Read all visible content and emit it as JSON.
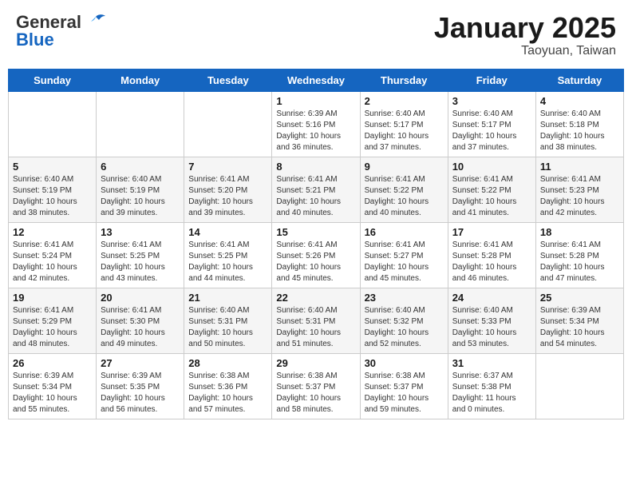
{
  "header": {
    "logo_general": "General",
    "logo_blue": "Blue",
    "title": "January 2025",
    "subtitle": "Taoyuan, Taiwan"
  },
  "days_of_week": [
    "Sunday",
    "Monday",
    "Tuesday",
    "Wednesday",
    "Thursday",
    "Friday",
    "Saturday"
  ],
  "weeks": [
    [
      {
        "day": "",
        "sunrise": "",
        "sunset": "",
        "daylight": ""
      },
      {
        "day": "",
        "sunrise": "",
        "sunset": "",
        "daylight": ""
      },
      {
        "day": "",
        "sunrise": "",
        "sunset": "",
        "daylight": ""
      },
      {
        "day": "1",
        "sunrise": "Sunrise: 6:39 AM",
        "sunset": "Sunset: 5:16 PM",
        "daylight": "Daylight: 10 hours and 36 minutes."
      },
      {
        "day": "2",
        "sunrise": "Sunrise: 6:40 AM",
        "sunset": "Sunset: 5:17 PM",
        "daylight": "Daylight: 10 hours and 37 minutes."
      },
      {
        "day": "3",
        "sunrise": "Sunrise: 6:40 AM",
        "sunset": "Sunset: 5:17 PM",
        "daylight": "Daylight: 10 hours and 37 minutes."
      },
      {
        "day": "4",
        "sunrise": "Sunrise: 6:40 AM",
        "sunset": "Sunset: 5:18 PM",
        "daylight": "Daylight: 10 hours and 38 minutes."
      }
    ],
    [
      {
        "day": "5",
        "sunrise": "Sunrise: 6:40 AM",
        "sunset": "Sunset: 5:19 PM",
        "daylight": "Daylight: 10 hours and 38 minutes."
      },
      {
        "day": "6",
        "sunrise": "Sunrise: 6:40 AM",
        "sunset": "Sunset: 5:19 PM",
        "daylight": "Daylight: 10 hours and 39 minutes."
      },
      {
        "day": "7",
        "sunrise": "Sunrise: 6:41 AM",
        "sunset": "Sunset: 5:20 PM",
        "daylight": "Daylight: 10 hours and 39 minutes."
      },
      {
        "day": "8",
        "sunrise": "Sunrise: 6:41 AM",
        "sunset": "Sunset: 5:21 PM",
        "daylight": "Daylight: 10 hours and 40 minutes."
      },
      {
        "day": "9",
        "sunrise": "Sunrise: 6:41 AM",
        "sunset": "Sunset: 5:22 PM",
        "daylight": "Daylight: 10 hours and 40 minutes."
      },
      {
        "day": "10",
        "sunrise": "Sunrise: 6:41 AM",
        "sunset": "Sunset: 5:22 PM",
        "daylight": "Daylight: 10 hours and 41 minutes."
      },
      {
        "day": "11",
        "sunrise": "Sunrise: 6:41 AM",
        "sunset": "Sunset: 5:23 PM",
        "daylight": "Daylight: 10 hours and 42 minutes."
      }
    ],
    [
      {
        "day": "12",
        "sunrise": "Sunrise: 6:41 AM",
        "sunset": "Sunset: 5:24 PM",
        "daylight": "Daylight: 10 hours and 42 minutes."
      },
      {
        "day": "13",
        "sunrise": "Sunrise: 6:41 AM",
        "sunset": "Sunset: 5:25 PM",
        "daylight": "Daylight: 10 hours and 43 minutes."
      },
      {
        "day": "14",
        "sunrise": "Sunrise: 6:41 AM",
        "sunset": "Sunset: 5:25 PM",
        "daylight": "Daylight: 10 hours and 44 minutes."
      },
      {
        "day": "15",
        "sunrise": "Sunrise: 6:41 AM",
        "sunset": "Sunset: 5:26 PM",
        "daylight": "Daylight: 10 hours and 45 minutes."
      },
      {
        "day": "16",
        "sunrise": "Sunrise: 6:41 AM",
        "sunset": "Sunset: 5:27 PM",
        "daylight": "Daylight: 10 hours and 45 minutes."
      },
      {
        "day": "17",
        "sunrise": "Sunrise: 6:41 AM",
        "sunset": "Sunset: 5:28 PM",
        "daylight": "Daylight: 10 hours and 46 minutes."
      },
      {
        "day": "18",
        "sunrise": "Sunrise: 6:41 AM",
        "sunset": "Sunset: 5:28 PM",
        "daylight": "Daylight: 10 hours and 47 minutes."
      }
    ],
    [
      {
        "day": "19",
        "sunrise": "Sunrise: 6:41 AM",
        "sunset": "Sunset: 5:29 PM",
        "daylight": "Daylight: 10 hours and 48 minutes."
      },
      {
        "day": "20",
        "sunrise": "Sunrise: 6:41 AM",
        "sunset": "Sunset: 5:30 PM",
        "daylight": "Daylight: 10 hours and 49 minutes."
      },
      {
        "day": "21",
        "sunrise": "Sunrise: 6:40 AM",
        "sunset": "Sunset: 5:31 PM",
        "daylight": "Daylight: 10 hours and 50 minutes."
      },
      {
        "day": "22",
        "sunrise": "Sunrise: 6:40 AM",
        "sunset": "Sunset: 5:31 PM",
        "daylight": "Daylight: 10 hours and 51 minutes."
      },
      {
        "day": "23",
        "sunrise": "Sunrise: 6:40 AM",
        "sunset": "Sunset: 5:32 PM",
        "daylight": "Daylight: 10 hours and 52 minutes."
      },
      {
        "day": "24",
        "sunrise": "Sunrise: 6:40 AM",
        "sunset": "Sunset: 5:33 PM",
        "daylight": "Daylight: 10 hours and 53 minutes."
      },
      {
        "day": "25",
        "sunrise": "Sunrise: 6:39 AM",
        "sunset": "Sunset: 5:34 PM",
        "daylight": "Daylight: 10 hours and 54 minutes."
      }
    ],
    [
      {
        "day": "26",
        "sunrise": "Sunrise: 6:39 AM",
        "sunset": "Sunset: 5:34 PM",
        "daylight": "Daylight: 10 hours and 55 minutes."
      },
      {
        "day": "27",
        "sunrise": "Sunrise: 6:39 AM",
        "sunset": "Sunset: 5:35 PM",
        "daylight": "Daylight: 10 hours and 56 minutes."
      },
      {
        "day": "28",
        "sunrise": "Sunrise: 6:38 AM",
        "sunset": "Sunset: 5:36 PM",
        "daylight": "Daylight: 10 hours and 57 minutes."
      },
      {
        "day": "29",
        "sunrise": "Sunrise: 6:38 AM",
        "sunset": "Sunset: 5:37 PM",
        "daylight": "Daylight: 10 hours and 58 minutes."
      },
      {
        "day": "30",
        "sunrise": "Sunrise: 6:38 AM",
        "sunset": "Sunset: 5:37 PM",
        "daylight": "Daylight: 10 hours and 59 minutes."
      },
      {
        "day": "31",
        "sunrise": "Sunrise: 6:37 AM",
        "sunset": "Sunset: 5:38 PM",
        "daylight": "Daylight: 11 hours and 0 minutes."
      },
      {
        "day": "",
        "sunrise": "",
        "sunset": "",
        "daylight": ""
      }
    ]
  ]
}
